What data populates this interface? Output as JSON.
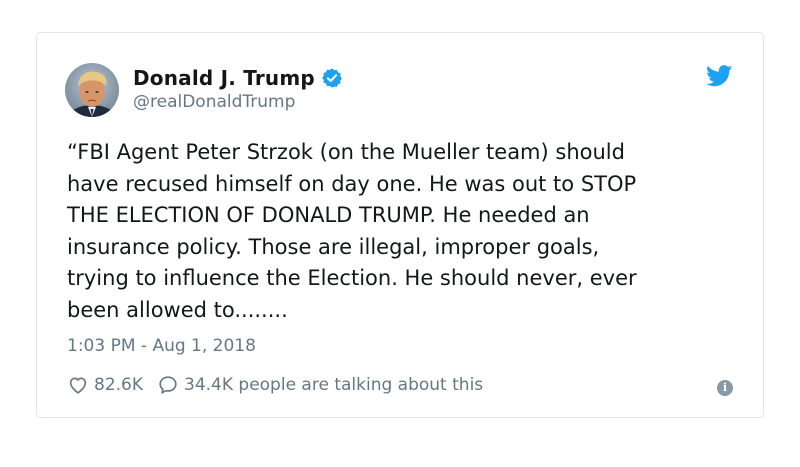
{
  "tweet": {
    "author": {
      "display_name": "Donald J. Trump",
      "handle": "@realDonaldTrump",
      "verified": true,
      "avatar_icon": "profile-photo"
    },
    "text_lines": [
      "“FBI Agent Peter Strzok (on the Mueller team) should",
      "have recused himself on day one. He was out to STOP",
      "THE ELECTION OF DONALD TRUMP. He needed an",
      "insurance policy. Those are illegal, improper goals,",
      "trying to influence the Election. He should never, ever",
      "been allowed to........"
    ],
    "timestamp": "1:03 PM - Aug 1, 2018",
    "likes": "82.6K",
    "talking": "34.4K people are talking about this"
  },
  "colors": {
    "twitter_blue": "#1da1f2",
    "text_primary": "#14171a",
    "text_secondary": "#657786",
    "border": "#e1e8ed"
  },
  "icons": {
    "brand": "twitter-bird-icon",
    "verified": "verified-badge-icon",
    "like": "heart-icon",
    "reply": "speech-bubble-icon",
    "info": "info-icon"
  }
}
